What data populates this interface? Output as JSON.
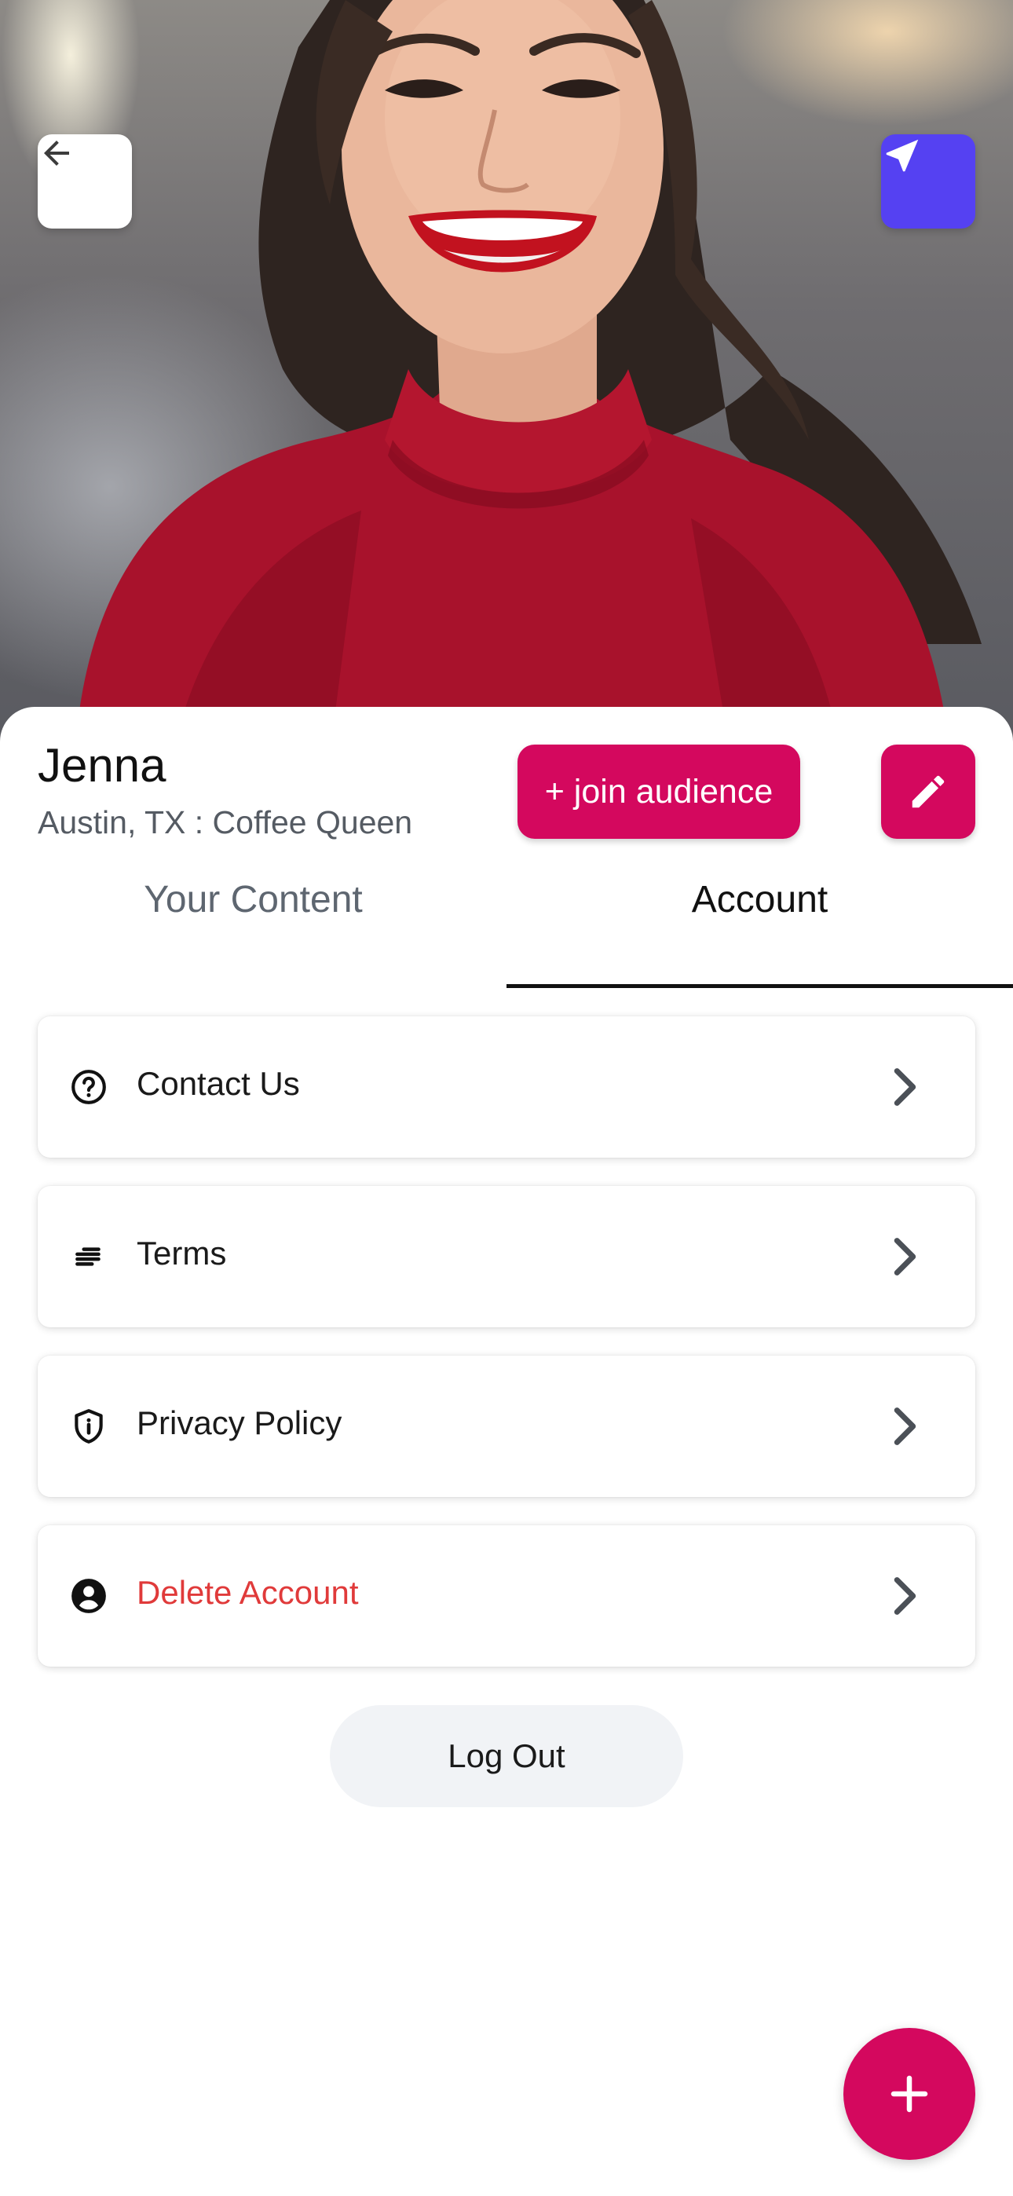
{
  "profile": {
    "name": "Jenna",
    "subtitle": "Austin, TX : Coffee Queen",
    "join_label": "+ join audience"
  },
  "icons": {
    "back": "arrow-left-icon",
    "send": "navigation-arrow-icon",
    "edit": "pencil-icon",
    "add": "plus-icon"
  },
  "tabs": [
    {
      "label": "Your Content",
      "active": false
    },
    {
      "label": "Account",
      "active": true
    }
  ],
  "menu": [
    {
      "label": "Contact Us",
      "icon": "help-circle-icon"
    },
    {
      "label": "Terms",
      "icon": "text-lines-icon"
    },
    {
      "label": "Privacy Policy",
      "icon": "shield-info-icon"
    },
    {
      "label": "Delete Account",
      "icon": "account-circle-icon"
    }
  ],
  "logout_label": "Log Out",
  "colors": {
    "accent": "#d4085e",
    "send_button": "#5541f2",
    "danger": "#e03a3a",
    "tab_active": "#111111",
    "tab_inactive": "#5e6670"
  }
}
